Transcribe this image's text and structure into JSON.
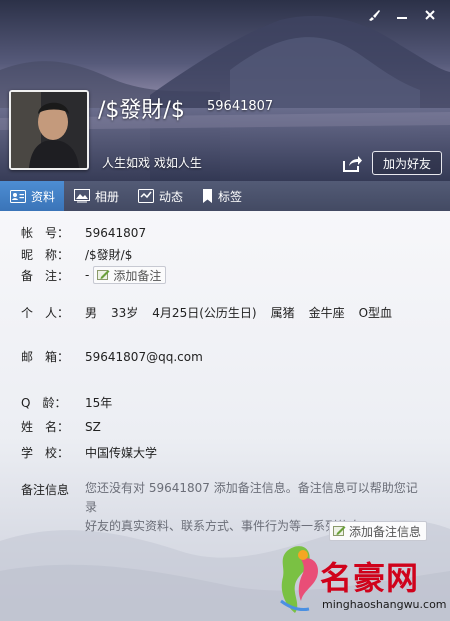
{
  "header": {
    "nickname": "/$發財/$",
    "qq_number": "59641807",
    "signature": "人生如戏 戏如人生",
    "add_friend_label": "加为好友"
  },
  "tabs": [
    {
      "label": "资料",
      "icon": "profile-card-icon",
      "active": true
    },
    {
      "label": "相册",
      "icon": "photo-album-icon",
      "active": false
    },
    {
      "label": "动态",
      "icon": "feed-icon",
      "active": false
    },
    {
      "label": "标签",
      "icon": "bookmark-icon",
      "active": false
    }
  ],
  "profile": {
    "account": {
      "label": "帐　号：",
      "value": "59641807"
    },
    "nickname": {
      "label": "昵　称：",
      "value": "/$發財/$"
    },
    "note": {
      "label": "备　注：",
      "value": "-",
      "button": "添加备注"
    },
    "personal": {
      "label": "个　人：",
      "gender": "男",
      "age": "33岁",
      "birthday": "4月25日(公历生日)",
      "zodiac": "属猪",
      "constellation": "金牛座",
      "blood": "O型血"
    },
    "email": {
      "label": "邮　箱：",
      "value": "59641807@qq.com"
    },
    "qage": {
      "label": "Q　龄：",
      "value": "15年"
    },
    "name": {
      "label": "姓　名：",
      "value": "SZ"
    },
    "school": {
      "label": "学　校：",
      "value": "中国传媒大学"
    },
    "remark": {
      "label": "备注信息",
      "line1": "您还没有对 59641807 添加备注信息。备注信息可以帮助您记录",
      "line2": "好友的真实资料、联系方式、事件行为等一系列信息。",
      "button": "添加备注信息"
    }
  },
  "watermark": {
    "title": "名豪网",
    "url": "minghaoshangwu.com"
  },
  "colors": {
    "tab_active": "#3f7fc4",
    "tab_bar": "#4a516b",
    "watermark_red": "#d0021b"
  }
}
